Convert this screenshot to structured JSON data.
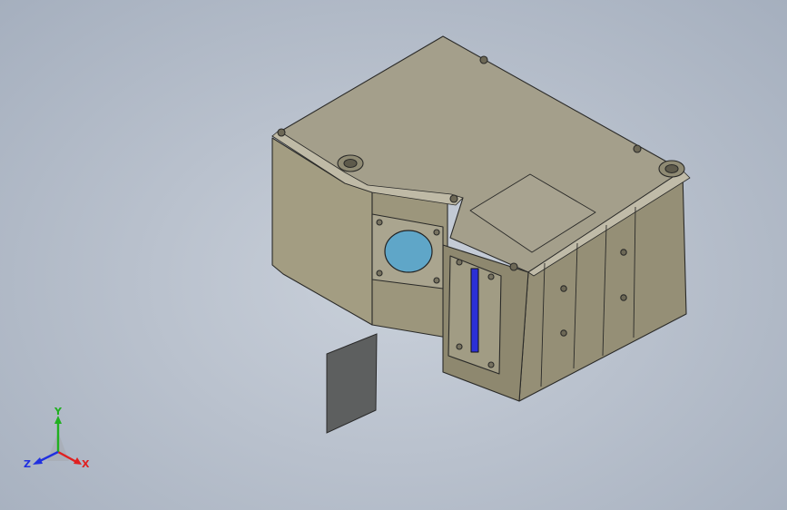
{
  "viewport": {
    "background_color": "#b9c1cd",
    "model": {
      "body_color": "#9b957d",
      "edge_color": "#2a2a28",
      "lens_color": "#5fa6c8",
      "indicator_color": "#2b2fd6"
    },
    "triad": {
      "x_label": "X",
      "y_label": "Y",
      "z_label": "Z",
      "x_color": "#e02020",
      "y_color": "#20b020",
      "z_color": "#2030e0"
    }
  }
}
